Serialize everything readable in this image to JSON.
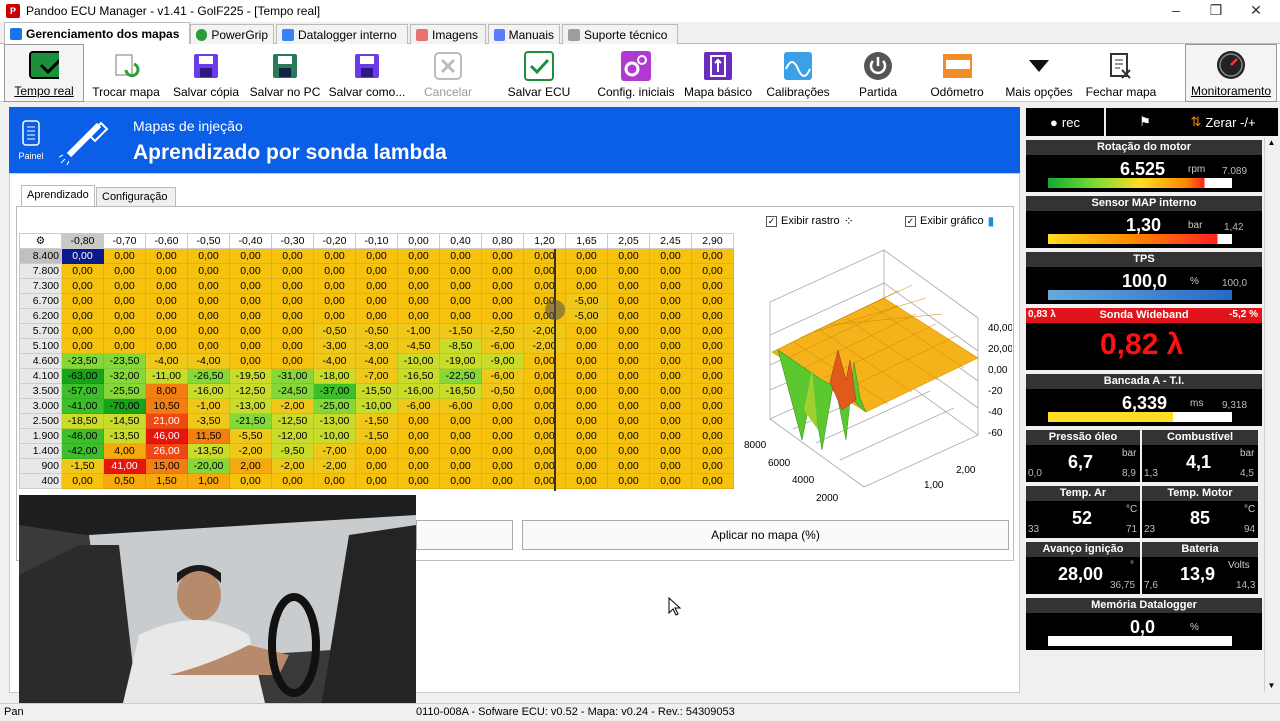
{
  "window": {
    "title": "Pandoo ECU Manager - v1.41 - GolF225 - [Tempo real]"
  },
  "tabs": [
    {
      "label": "Gerenciamento dos mapas",
      "active": true,
      "icon": "home-icon"
    },
    {
      "label": "PowerGrip",
      "icon": "powergrip-icon"
    },
    {
      "label": "Datalogger interno",
      "icon": "chart-icon"
    },
    {
      "label": "Imagens",
      "icon": "image-icon"
    },
    {
      "label": "Manuais",
      "icon": "book-icon"
    },
    {
      "label": "Suporte técnico",
      "icon": "support-icon"
    }
  ],
  "toolbar": [
    {
      "label": "Tempo real",
      "icon": "realtime-check-icon"
    },
    {
      "label": "Trocar mapa",
      "icon": "swap-map-icon"
    },
    {
      "label": "Salvar cópia",
      "icon": "floppy-icon"
    },
    {
      "label": "Salvar no PC",
      "icon": "floppy-pc-icon"
    },
    {
      "label": "Salvar como...",
      "icon": "floppy-as-icon"
    },
    {
      "label": "Cancelar",
      "icon": "cancel-icon",
      "disabled": true
    },
    {
      "label": "Salvar ECU",
      "icon": "save-ecu-check-icon"
    },
    {
      "label": "Config. iniciais",
      "icon": "gears-icon"
    },
    {
      "label": "Mapa básico",
      "icon": "basic-map-icon"
    },
    {
      "label": "Calibrações",
      "icon": "calibration-icon"
    },
    {
      "label": "Partida",
      "icon": "power-icon"
    },
    {
      "label": "Odômetro",
      "icon": "odometer-icon"
    },
    {
      "label": "Mais opções",
      "icon": "triangle-down-icon"
    },
    {
      "label": "Fechar mapa",
      "icon": "close-map-icon"
    },
    {
      "label": "Monitoramento",
      "icon": "gauge-icon"
    }
  ],
  "header": {
    "painel": "Painel",
    "subtitle": "Mapas de injeção",
    "title": "Aprendizado por sonda lambda"
  },
  "subtabs": [
    "Aprendizado",
    "Configuração"
  ],
  "options": {
    "exibir_rastro": "Exibir rastro",
    "exibir_grafico": "Exibir gráfico"
  },
  "grid": {
    "columns": [
      "-0,80",
      "-0,70",
      "-0,60",
      "-0,50",
      "-0,40",
      "-0,30",
      "-0,20",
      "-0,10",
      "0,00",
      "0,40",
      "0,80",
      "1,20",
      "1,65",
      "2,05",
      "2,45",
      "2,90"
    ],
    "rows": [
      {
        "rpm": "8.400",
        "v": [
          "0,00",
          "0,00",
          "0,00",
          "0,00",
          "0,00",
          "0,00",
          "0,00",
          "0,00",
          "0,00",
          "0,00",
          "0,00",
          "0,00",
          "0,00",
          "0,00",
          "0,00",
          "0,00"
        ]
      },
      {
        "rpm": "7.800",
        "v": [
          "0,00",
          "0,00",
          "0,00",
          "0,00",
          "0,00",
          "0,00",
          "0,00",
          "0,00",
          "0,00",
          "0,00",
          "0,00",
          "0,00",
          "0,00",
          "0,00",
          "0,00",
          "0,00"
        ]
      },
      {
        "rpm": "7.300",
        "v": [
          "0,00",
          "0,00",
          "0,00",
          "0,00",
          "0,00",
          "0,00",
          "0,00",
          "0,00",
          "0,00",
          "0,00",
          "0,00",
          "0,00",
          "0,00",
          "0,00",
          "0,00",
          "0,00"
        ]
      },
      {
        "rpm": "6.700",
        "v": [
          "0,00",
          "0,00",
          "0,00",
          "0,00",
          "0,00",
          "0,00",
          "0,00",
          "0,00",
          "0,00",
          "0,00",
          "0,00",
          "0,00",
          "-5,00",
          "0,00",
          "0,00",
          "0,00"
        ]
      },
      {
        "rpm": "6.200",
        "v": [
          "0,00",
          "0,00",
          "0,00",
          "0,00",
          "0,00",
          "0,00",
          "0,00",
          "0,00",
          "0,00",
          "0,00",
          "0,00",
          "0,00",
          "-5,00",
          "0,00",
          "0,00",
          "0,00"
        ]
      },
      {
        "rpm": "5.700",
        "v": [
          "0,00",
          "0,00",
          "0,00",
          "0,00",
          "0,00",
          "0,00",
          "-0,50",
          "-0,50",
          "-1,00",
          "-1,50",
          "-2,50",
          "-2,00",
          "0,00",
          "0,00",
          "0,00",
          "0,00"
        ]
      },
      {
        "rpm": "5.100",
        "v": [
          "0,00",
          "0,00",
          "0,00",
          "0,00",
          "0,00",
          "0,00",
          "-3,00",
          "-3,00",
          "-4,50",
          "-8,50",
          "-6,00",
          "-2,00",
          "0,00",
          "0,00",
          "0,00",
          "0,00"
        ]
      },
      {
        "rpm": "4.600",
        "v": [
          "-23,50",
          "-23,50",
          "-4,00",
          "-4,00",
          "0,00",
          "0,00",
          "-4,00",
          "-4,00",
          "-10,00",
          "-19,00",
          "-9,00",
          "0,00",
          "0,00",
          "0,00",
          "0,00",
          "0,00"
        ]
      },
      {
        "rpm": "4.100",
        "v": [
          "-63,00",
          "-32,00",
          "-11,00",
          "-26,50",
          "-19,50",
          "-31,00",
          "-18,00",
          "-7,00",
          "-16,50",
          "-22,50",
          "-6,00",
          "0,00",
          "0,00",
          "0,00",
          "0,00",
          "0,00"
        ]
      },
      {
        "rpm": "3.500",
        "v": [
          "-57,00",
          "-25,50",
          "8,00",
          "-16,00",
          "-12,50",
          "-24,50",
          "-37,00",
          "-15,50",
          "-16,00",
          "-16,50",
          "-0,50",
          "0,00",
          "0,00",
          "0,00",
          "0,00",
          "0,00"
        ]
      },
      {
        "rpm": "3.000",
        "v": [
          "-41,00",
          "-70,00",
          "10,50",
          "-1,00",
          "-13,00",
          "-2,00",
          "-25,00",
          "-10,00",
          "-6,00",
          "-6,00",
          "0,00",
          "0,00",
          "0,00",
          "0,00",
          "0,00",
          "0,00"
        ]
      },
      {
        "rpm": "2.500",
        "v": [
          "-18,50",
          "-14,50",
          "21,00",
          "-3,50",
          "-21,50",
          "-12,50",
          "-13,00",
          "-1,50",
          "0,00",
          "0,00",
          "0,00",
          "0,00",
          "0,00",
          "0,00",
          "0,00",
          "0,00"
        ]
      },
      {
        "rpm": "1.900",
        "v": [
          "-46,00",
          "-13,50",
          "46,00",
          "11,50",
          "-5,50",
          "-12,00",
          "-10,00",
          "-1,50",
          "0,00",
          "0,00",
          "0,00",
          "0,00",
          "0,00",
          "0,00",
          "0,00",
          "0,00"
        ]
      },
      {
        "rpm": "1.400",
        "v": [
          "-42,00",
          "4,00",
          "26,00",
          "-13,50",
          "-2,00",
          "-9,50",
          "-7,00",
          "0,00",
          "0,00",
          "0,00",
          "0,00",
          "0,00",
          "0,00",
          "0,00",
          "0,00",
          "0,00"
        ]
      },
      {
        "rpm": "900",
        "v": [
          "-1,50",
          "41,00",
          "15,00",
          "-20,00",
          "2,00",
          "-2,00",
          "-2,00",
          "0,00",
          "0,00",
          "0,00",
          "0,00",
          "0,00",
          "0,00",
          "0,00",
          "0,00",
          "0,00"
        ]
      },
      {
        "rpm": "400",
        "v": [
          "0,00",
          "0,50",
          "1,50",
          "1,00",
          "0,00",
          "0,00",
          "0,00",
          "0,00",
          "0,00",
          "0,00",
          "0,00",
          "0,00",
          "0,00",
          "0,00",
          "0,00",
          "0,00"
        ]
      }
    ]
  },
  "chart3d": {
    "z_ticks": [
      "40,00",
      "20,00",
      "0,00",
      "-20",
      "-40",
      "-60"
    ],
    "y_ticks": [
      "8000",
      "6000",
      "4000",
      "2000"
    ],
    "x_ticks": [
      "2,00",
      "1,00"
    ]
  },
  "buttons": {
    "aplicar": "Aplicar no mapa (%)"
  },
  "status": {
    "left": "Pan",
    "right": "0110-008A - Sofware ECU: v0.52 - Mapa: v0.24 - Rev.: 54309053"
  },
  "rightpanel": {
    "rec": "rec",
    "zerar": "Zerar -/+",
    "rotacao": {
      "title": "Rotação do motor",
      "value": "6.525",
      "unit": "rpm",
      "max": "7.089"
    },
    "map": {
      "title": "Sensor MAP interno",
      "value": "1,30",
      "unit": "bar",
      "max": "1,42"
    },
    "tps": {
      "title": "TPS",
      "value": "100,0",
      "unit": "%",
      "max": "100,0"
    },
    "sonda": {
      "title": "Sonda Wideband",
      "left": "0,83 λ",
      "right": "-5,2 %",
      "value": "0,82 λ"
    },
    "bancada": {
      "title": "Bancada A - T.I.",
      "value": "6,339",
      "unit": "ms",
      "max": "9,318"
    },
    "oleo": {
      "title": "Pressão óleo",
      "value": "6,7",
      "unit": "bar",
      "min": "0,0",
      "max": "8,9"
    },
    "comb": {
      "title": "Combustível",
      "value": "4,1",
      "unit": "bar",
      "min": "1,3",
      "max": "4,5"
    },
    "tar": {
      "title": "Temp. Ar",
      "value": "52",
      "unit": "°C",
      "min": "33",
      "max": "71"
    },
    "tmotor": {
      "title": "Temp. Motor",
      "value": "85",
      "unit": "°C",
      "min": "23",
      "max": "94"
    },
    "avanco": {
      "title": "Avanço ignição",
      "value": "28,00",
      "unit": "°",
      "min": "",
      "max": "36,75"
    },
    "bateria": {
      "title": "Bateria",
      "value": "13,9",
      "unit": "Volts",
      "min": "7,6",
      "max": "14,3"
    },
    "memoria": {
      "title": "Memória Datalogger",
      "value": "0,0",
      "unit": "%"
    }
  }
}
